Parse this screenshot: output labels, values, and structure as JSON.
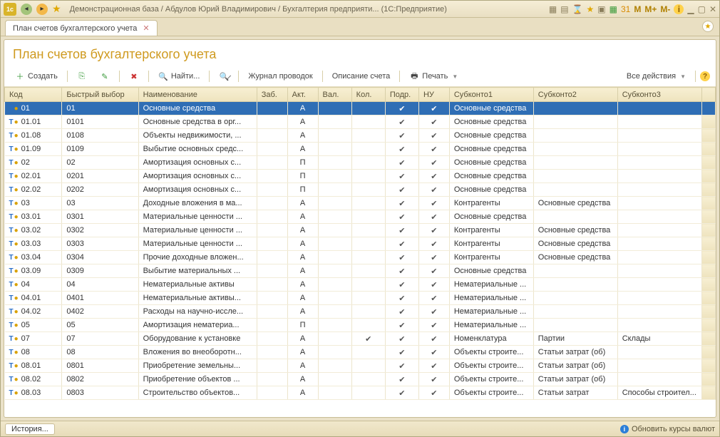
{
  "window": {
    "title": "Демонстрационная база / Абдулов Юрий Владимирович / Бухгалтерия предприяти...   (1С:Предприятие)"
  },
  "tab": {
    "label": "План счетов бухгалтерского учета"
  },
  "page": {
    "title": "План счетов бухгалтерского учета"
  },
  "toolbar": {
    "create": "Создать",
    "find": "Найти...",
    "journal": "Журнал проводок",
    "descr": "Описание счета",
    "print": "Печать",
    "all_actions": "Все действия"
  },
  "columns": {
    "code": "Код",
    "fast": "Быстрый выбор",
    "name": "Наименование",
    "zab": "Заб.",
    "akt": "Акт.",
    "val": "Вал.",
    "kol": "Кол.",
    "podr": "Подр.",
    "nu": "НУ",
    "s1": "Субконто1",
    "s2": "Субконто2",
    "s3": "Субконто3"
  },
  "rows": [
    {
      "code": "01",
      "fast": "01",
      "name": "Основные средства",
      "akt": "А",
      "podr": true,
      "nu": true,
      "s1": "Основные средства",
      "s2": "",
      "s3": "",
      "sel": true
    },
    {
      "code": "01.01",
      "fast": "0101",
      "name": "Основные средства в орг...",
      "akt": "А",
      "podr": true,
      "nu": true,
      "s1": "Основные средства",
      "s2": "",
      "s3": ""
    },
    {
      "code": "01.08",
      "fast": "0108",
      "name": "Объекты недвижимости, ...",
      "akt": "А",
      "podr": true,
      "nu": true,
      "s1": "Основные средства",
      "s2": "",
      "s3": ""
    },
    {
      "code": "01.09",
      "fast": "0109",
      "name": "Выбытие основных средс...",
      "akt": "А",
      "podr": true,
      "nu": true,
      "s1": "Основные средства",
      "s2": "",
      "s3": ""
    },
    {
      "code": "02",
      "fast": "02",
      "name": "Амортизация основных с...",
      "akt": "П",
      "podr": true,
      "nu": true,
      "s1": "Основные средства",
      "s2": "",
      "s3": ""
    },
    {
      "code": "02.01",
      "fast": "0201",
      "name": "Амортизация основных с...",
      "akt": "П",
      "podr": true,
      "nu": true,
      "s1": "Основные средства",
      "s2": "",
      "s3": ""
    },
    {
      "code": "02.02",
      "fast": "0202",
      "name": "Амортизация основных с...",
      "akt": "П",
      "podr": true,
      "nu": true,
      "s1": "Основные средства",
      "s2": "",
      "s3": ""
    },
    {
      "code": "03",
      "fast": "03",
      "name": "Доходные вложения в ма...",
      "akt": "А",
      "podr": true,
      "nu": true,
      "s1": "Контрагенты",
      "s2": "Основные средства",
      "s3": ""
    },
    {
      "code": "03.01",
      "fast": "0301",
      "name": "Материальные ценности ...",
      "akt": "А",
      "podr": true,
      "nu": true,
      "s1": "Основные средства",
      "s2": "",
      "s3": ""
    },
    {
      "code": "03.02",
      "fast": "0302",
      "name": "Материальные ценности ...",
      "akt": "А",
      "podr": true,
      "nu": true,
      "s1": "Контрагенты",
      "s2": "Основные средства",
      "s3": ""
    },
    {
      "code": "03.03",
      "fast": "0303",
      "name": "Материальные ценности ...",
      "akt": "А",
      "podr": true,
      "nu": true,
      "s1": "Контрагенты",
      "s2": "Основные средства",
      "s3": ""
    },
    {
      "code": "03.04",
      "fast": "0304",
      "name": "Прочие доходные вложен...",
      "akt": "А",
      "podr": true,
      "nu": true,
      "s1": "Контрагенты",
      "s2": "Основные средства",
      "s3": ""
    },
    {
      "code": "03.09",
      "fast": "0309",
      "name": "Выбытие материальных ...",
      "akt": "А",
      "podr": true,
      "nu": true,
      "s1": "Основные средства",
      "s2": "",
      "s3": ""
    },
    {
      "code": "04",
      "fast": "04",
      "name": "Нематериальные активы",
      "akt": "А",
      "podr": true,
      "nu": true,
      "s1": "Нематериальные ...",
      "s2": "",
      "s3": ""
    },
    {
      "code": "04.01",
      "fast": "0401",
      "name": "Нематериальные активы...",
      "akt": "А",
      "podr": true,
      "nu": true,
      "s1": "Нематериальные ...",
      "s2": "",
      "s3": ""
    },
    {
      "code": "04.02",
      "fast": "0402",
      "name": "Расходы на научно-иссле...",
      "akt": "А",
      "podr": true,
      "nu": true,
      "s1": "Нематериальные ...",
      "s2": "",
      "s3": ""
    },
    {
      "code": "05",
      "fast": "05",
      "name": "Амортизация нематериа...",
      "akt": "П",
      "podr": true,
      "nu": true,
      "s1": "Нематериальные ...",
      "s2": "",
      "s3": ""
    },
    {
      "code": "07",
      "fast": "07",
      "name": "Оборудование к установке",
      "akt": "А",
      "kol": true,
      "podr": true,
      "nu": true,
      "s1": "Номенклатура",
      "s2": "Партии",
      "s3": "Склады"
    },
    {
      "code": "08",
      "fast": "08",
      "name": "Вложения во внеоборотн...",
      "akt": "А",
      "podr": true,
      "nu": true,
      "s1": "Объекты строите...",
      "s2": "Статьи затрат (об)",
      "s3": ""
    },
    {
      "code": "08.01",
      "fast": "0801",
      "name": "Приобретение земельны...",
      "akt": "А",
      "podr": true,
      "nu": true,
      "s1": "Объекты строите...",
      "s2": "Статьи затрат (об)",
      "s3": ""
    },
    {
      "code": "08.02",
      "fast": "0802",
      "name": "Приобретение объектов ...",
      "akt": "А",
      "podr": true,
      "nu": true,
      "s1": "Объекты строите...",
      "s2": "Статьи затрат (об)",
      "s3": ""
    },
    {
      "code": "08.03",
      "fast": "0803",
      "name": "Строительство объектов...",
      "akt": "А",
      "podr": true,
      "nu": true,
      "s1": "Объекты строите...",
      "s2": "Статьи затрат",
      "s3": "Способы строител..."
    }
  ],
  "statusbar": {
    "history": "История...",
    "rates": "Обновить курсы валют"
  }
}
